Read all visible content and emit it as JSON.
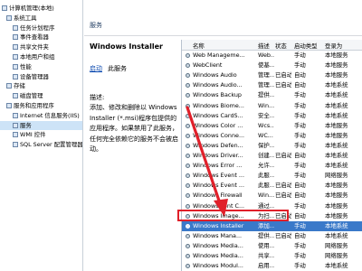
{
  "tree": {
    "items": [
      "计算机管理(本地)",
      "系统工具",
      "任务计划程序",
      "事件查看器",
      "共享文件夹",
      "本地用户和组",
      "性能",
      "设备管理器",
      "存储",
      "磁盘管理",
      "服务和应用程序",
      "Internet 信息服务(IIS)",
      "服务",
      "WMI 控件",
      "SQL Server 配置管理器"
    ],
    "selected_index": 12
  },
  "header": {
    "title": "服务"
  },
  "detail": {
    "name": "Windows Installer",
    "link": "启动",
    "link_tail": "此服务",
    "desc_label": "描述:",
    "description": "添加、修改和删除以 Windows Installer (*.msi)程序包提供的应用程序。如果禁用了此服务，任何完全依赖它的服务不会被启动。"
  },
  "grid": {
    "columns": [
      "名称",
      "描述",
      "状态",
      "启动类型",
      "登录为"
    ],
    "rows": [
      {
        "name": "Web Manageme...",
        "desc": "Web...",
        "status": "",
        "startup": "手动",
        "logon": "本地服务"
      },
      {
        "name": "WebClient",
        "desc": "使基...",
        "status": "",
        "startup": "手动",
        "logon": "本地服务"
      },
      {
        "name": "Windows Audio",
        "desc": "管理...",
        "status": "已启动",
        "startup": "自动",
        "logon": "本地服务"
      },
      {
        "name": "Windows Audio...",
        "desc": "管理...",
        "status": "已启动",
        "startup": "自动",
        "logon": "本地系统"
      },
      {
        "name": "Windows Backup",
        "desc": "提供...",
        "status": "",
        "startup": "手动",
        "logon": "本地系统"
      },
      {
        "name": "Windows Biome...",
        "desc": "Win...",
        "status": "",
        "startup": "手动",
        "logon": "本地系统"
      },
      {
        "name": "Windows CardS...",
        "desc": "安全...",
        "status": "",
        "startup": "手动",
        "logon": "本地系统"
      },
      {
        "name": "Windows Color ...",
        "desc": "Wcs...",
        "status": "",
        "startup": "手动",
        "logon": "本地服务"
      },
      {
        "name": "Windows Conne...",
        "desc": "WC...",
        "status": "",
        "startup": "手动",
        "logon": "本地服务"
      },
      {
        "name": "Windows Defen...",
        "desc": "保护...",
        "status": "",
        "startup": "手动",
        "logon": "本地系统"
      },
      {
        "name": "Windows Driver...",
        "desc": "创建...",
        "status": "已启动",
        "startup": "自动",
        "logon": "本地系统"
      },
      {
        "name": "Windows Error ...",
        "desc": "允许...",
        "status": "",
        "startup": "手动",
        "logon": "本地系统"
      },
      {
        "name": "Windows Event ...",
        "desc": "此服...",
        "status": "",
        "startup": "手动",
        "logon": "网络服务"
      },
      {
        "name": "Windows Event ...",
        "desc": "此服...",
        "status": "已启动",
        "startup": "自动",
        "logon": "本地服务"
      },
      {
        "name": "Windows Firewall",
        "desc": "Win...",
        "status": "已启动",
        "startup": "自动",
        "logon": "本地服务"
      },
      {
        "name": "Windows Font C...",
        "desc": "通过...",
        "status": "",
        "startup": "手动",
        "logon": "本地服务"
      },
      {
        "name": "Windows Image...",
        "desc": "为扫...",
        "status": "已启动",
        "startup": "自动",
        "logon": "本地服务"
      },
      {
        "name": "Windows Installer",
        "desc": "添加...",
        "status": "",
        "startup": "手动",
        "logon": "本地系统",
        "selected": true
      },
      {
        "name": "Windows Mana...",
        "desc": "提供...",
        "status": "已启动",
        "startup": "自动",
        "logon": "本地系统"
      },
      {
        "name": "Windows Media...",
        "desc": "使用...",
        "status": "",
        "startup": "手动",
        "logon": "网络服务"
      },
      {
        "name": "Windows Media...",
        "desc": "共享...",
        "status": "",
        "startup": "手动",
        "logon": "网络服务"
      },
      {
        "name": "Windows Modul...",
        "desc": "启用...",
        "status": "",
        "startup": "手动",
        "logon": "本地系统"
      }
    ]
  },
  "colors": {
    "selection": "#3a79c9",
    "highlight_box": "#e0202a",
    "arrow": "#e0202a"
  }
}
